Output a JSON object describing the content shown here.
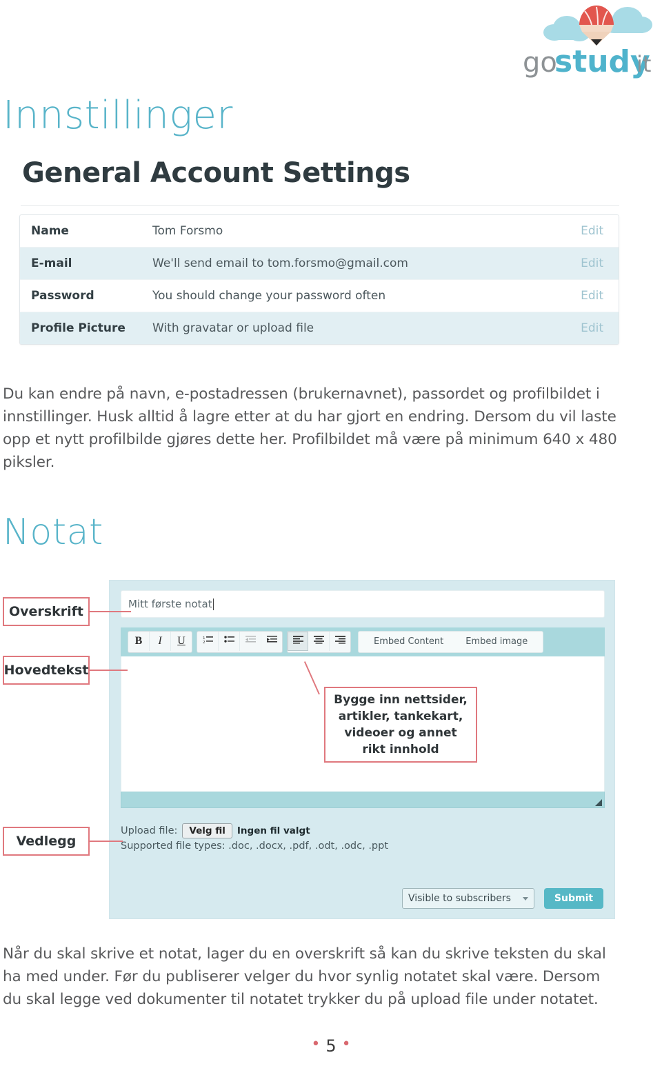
{
  "brand": {
    "logo_alt": "gostudyit-logo",
    "word_go": "go",
    "word_study": "study",
    "word_it": "it",
    "teal": "#58b4c9",
    "red": "#e05a52"
  },
  "headings": {
    "section_1": "Innstillinger",
    "section_2": "Notat"
  },
  "settings_screenshot": {
    "title": "General Account Settings",
    "rows": [
      {
        "label": "Name",
        "value": "Tom Forsmo",
        "action": "Edit"
      },
      {
        "label": "E-mail",
        "value": "We'll send email to tom.forsmo@gmail.com",
        "action": "Edit"
      },
      {
        "label": "Password",
        "value": "You should change your password often",
        "action": "Edit"
      },
      {
        "label": "Profile Picture",
        "value": "With gravatar or upload file",
        "action": "Edit"
      }
    ]
  },
  "paragraphs": {
    "p1": "Du kan endre på navn, e-postadressen (brukernavnet), passordet og profilbildet i innstillinger. Husk alltid å lagre etter at du har gjort en endring. Dersom du vil laste opp et nytt profilbilde gjøres dette her. Profilbildet må være på minimum 640 x 480 piksler.",
    "p2": "Når du skal skrive et notat, lager du en overskrift så kan du skrive teksten du skal ha med under. Før du publiserer velger du hvor synlig notatet skal være. Dersom du skal legge ved dokumenter til notatet trykker du på upload file under notatet."
  },
  "note_editor": {
    "title_value": "Mitt første notat",
    "toolbar": {
      "bold": "B",
      "italic": "I",
      "underline": "U",
      "ordered_list": "ordered-list-icon",
      "unordered_list": "unordered-list-icon",
      "outdent": "outdent-icon",
      "indent": "indent-icon",
      "align_left": "align-left-icon",
      "align_center": "align-center-icon",
      "align_right": "align-right-icon",
      "embed_content": "Embed Content",
      "embed_image": "Embed image"
    },
    "upload": {
      "label": "Upload file:",
      "button": "Velg fil",
      "status": "Ingen fil valgt",
      "supported": "Supported file types: .doc, .docx, .pdf, .odt, .odc, .ppt"
    },
    "visibility_selected": "Visible to subscribers",
    "submit_label": "Submit"
  },
  "annotations": {
    "overskrift": "Overskrift",
    "hovedtekst": "Hovedtekst",
    "vedlegg": "Vedlegg",
    "embed_note_line1": "Bygge inn nettsider,",
    "embed_note_line2": "artikler, tankekart,",
    "embed_note_line3": "videoer og annet",
    "embed_note_line4": "rikt innhold"
  },
  "footer": {
    "page_number": "5"
  }
}
